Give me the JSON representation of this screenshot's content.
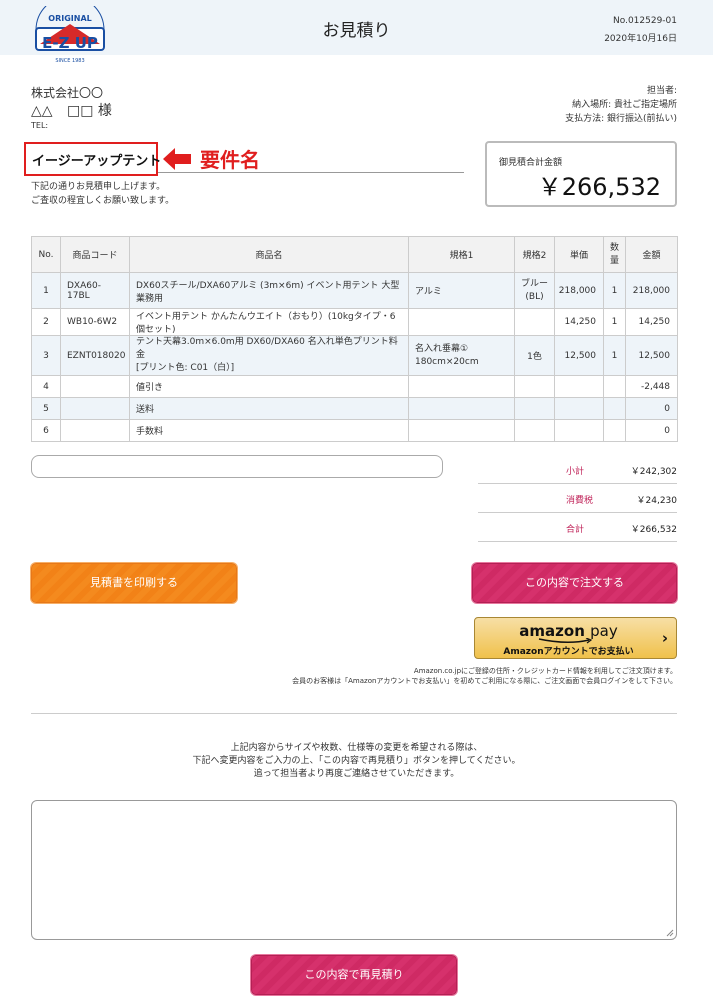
{
  "header": {
    "title": "お見積り",
    "estimate_no": "No.012529-01",
    "date": "2020年10月16日",
    "logo": {
      "top_text": "ORIGINAL",
      "main_text": "E-Z UP",
      "bottom_text": "SINCE 1983",
      "icon": "ez-up-logo"
    }
  },
  "customer": {
    "company": "株式会社〇〇",
    "name_left": "△△",
    "name_right": "□□",
    "honorific": "様",
    "tel_label": "TEL:"
  },
  "staff": {
    "rep": "担当者:",
    "delivery": "納入場所: 貴社ご指定場所",
    "payment": "支払方法: 銀行振込(前払い)"
  },
  "project": {
    "name": "イージーアップテント",
    "annotation": "要件名",
    "arrow_icon": "arrow-left-icon",
    "annotation_color": "#e01e1e"
  },
  "greeting": {
    "line1": "下記の通りお見積申し上げます。",
    "line2": "ご査収の程宜しくお願い致します。"
  },
  "total": {
    "label": "御見積合計金額",
    "amount": "￥266,532"
  },
  "table": {
    "headers": [
      "No.",
      "商品コード",
      "商品名",
      "規格1",
      "規格2",
      "単価",
      "数量",
      "金額"
    ],
    "rows": [
      {
        "no": "1",
        "code": "DXA60-17BL",
        "name": "DX60スチール/DXA60アルミ (3m×6m) イベント用テント 大型業務用",
        "name2": "",
        "spec1": "アルミ",
        "spec1b": "",
        "spec2": "ブルー",
        "spec2b": "(BL)",
        "price": "218,000",
        "qty": "1",
        "amount": "218,000"
      },
      {
        "no": "2",
        "code": "WB10-6W2",
        "name": "イベント用テント かんたんウエイト（おもり）(10kgタイプ・6個セット)",
        "name2": "",
        "spec1": "",
        "spec1b": "",
        "spec2": "",
        "spec2b": "",
        "price": "14,250",
        "qty": "1",
        "amount": "14,250"
      },
      {
        "no": "3",
        "code": "EZNT018020",
        "name": "テント天幕3.0m×6.0m用 DX60/DXA60 名入れ単色プリント料金",
        "name2": "[プリント色: C01（白）]",
        "spec1": "名入れ垂幕①",
        "spec1b": "180cm×20cm",
        "spec2": "1色",
        "spec2b": "",
        "price": "12,500",
        "qty": "1",
        "amount": "12,500"
      },
      {
        "no": "4",
        "code": "",
        "name": "値引き",
        "name2": "",
        "spec1": "",
        "spec1b": "",
        "spec2": "",
        "spec2b": "",
        "price": "",
        "qty": "",
        "amount": "-2,448"
      },
      {
        "no": "5",
        "code": "",
        "name": "送料",
        "name2": "",
        "spec1": "",
        "spec1b": "",
        "spec2": "",
        "spec2b": "",
        "price": "",
        "qty": "",
        "amount": "0"
      },
      {
        "no": "6",
        "code": "",
        "name": "手数料",
        "name2": "",
        "spec1": "",
        "spec1b": "",
        "spec2": "",
        "spec2b": "",
        "price": "",
        "qty": "",
        "amount": "0"
      }
    ]
  },
  "summary": {
    "subtotal_label": "小計",
    "subtotal": "￥242,302",
    "tax_label": "消費税",
    "tax": "￥24,230",
    "total_label": "合計",
    "total": "￥266,532"
  },
  "buttons": {
    "print": "見積書を印刷する",
    "order": "この内容で注文する",
    "reorder": "この内容で再見積り"
  },
  "amazon": {
    "brand": "amazon",
    "pay": "pay",
    "sub": "Amazonアカウントでお支払い",
    "chevron": "›",
    "note1": "Amazon.co.jpにご登録の住所・クレジットカード情報を利用してご注文頂けます。",
    "note2": "会員のお客様は「Amazonアカウントでお支払い」を初めてご利用になる際に、ご注文画面で会員ログインをして下さい。"
  },
  "instructions": {
    "line1": "上記内容からサイズや枚数、仕様等の変更を希望される際は、",
    "line2": "下記へ変更内容をご入力の上、「この内容で再見積り」ボタンを押してください。",
    "line3": "追って担当者より再度ご連絡させていただきます。"
  },
  "colors": {
    "header_bg": "#eef4f9",
    "accent_pink": "#d6316c",
    "accent_orange": "#f48a1e",
    "amazon_yellow": "#f0c14b"
  }
}
